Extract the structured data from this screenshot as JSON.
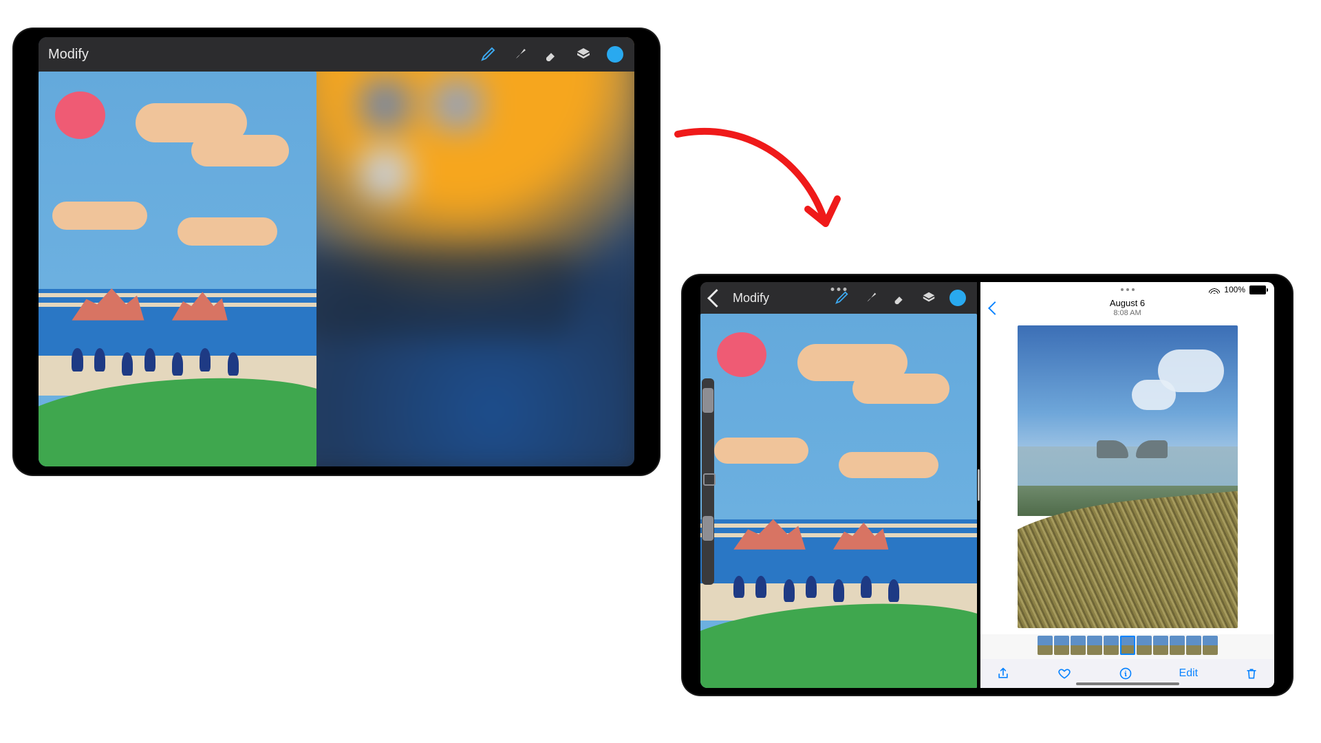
{
  "device1": {
    "app": {
      "modify_label": "Modify",
      "toolbar": {
        "brush_icon": "brush-icon",
        "smudge_icon": "smudge-icon",
        "eraser_icon": "eraser-icon",
        "layers_icon": "layers-icon",
        "color_swatch": "#29a9ef"
      }
    }
  },
  "device2": {
    "left_app": {
      "modify_label": "Modify",
      "toolbar": {
        "brush_icon": "brush-icon",
        "smudge_icon": "smudge-icon",
        "eraser_icon": "eraser-icon",
        "layers_icon": "layers-icon",
        "color_swatch": "#29a9ef"
      }
    },
    "right_app": {
      "status": {
        "battery_pct": "100%"
      },
      "nav": {
        "title": "August 6",
        "subtitle": "8:08 AM"
      },
      "toolbar": {
        "share_label": "share-icon",
        "favorite_label": "heart-icon",
        "info_label": "info-icon",
        "edit_label": "Edit",
        "trash_label": "trash-icon"
      }
    }
  }
}
